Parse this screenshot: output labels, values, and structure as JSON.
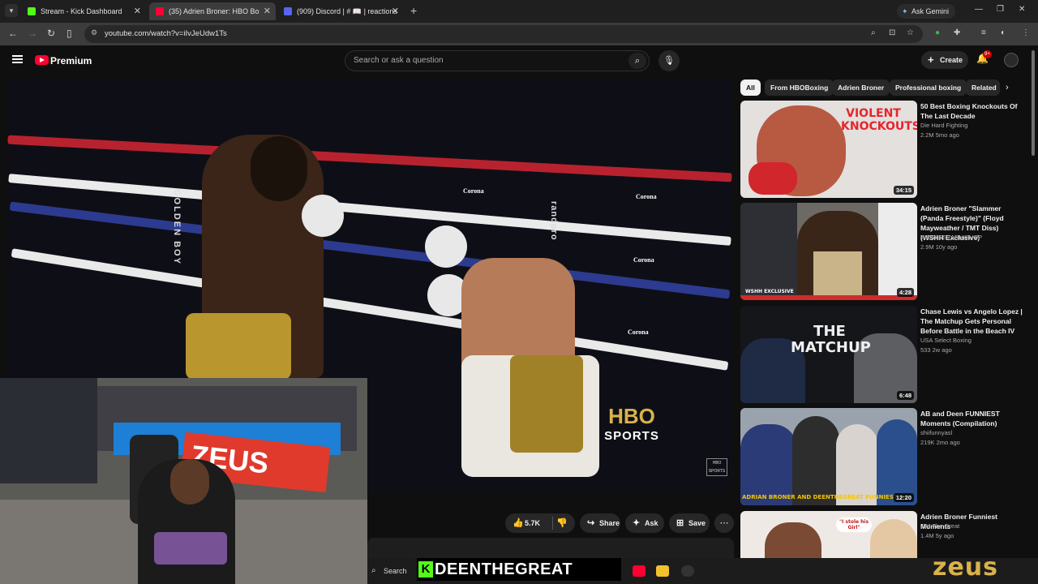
{
  "browser": {
    "tabs": [
      {
        "title": "Stream - Kick Dashboard",
        "active": false,
        "icon_color": "#53fc18"
      },
      {
        "title": "(35) Adrien Broner: HBO Bo",
        "active": true,
        "icon_color": "#ff0033"
      },
      {
        "title": "(909) Discord | # 📖 | reactions",
        "active": false,
        "icon_color": "#5865f2"
      }
    ],
    "new_tab": "+",
    "gemini_label": "Ask Gemini",
    "url": "youtube.com/watch?v=iIvJeUdw1Ts"
  },
  "youtube": {
    "brand": "Premium",
    "search_placeholder": "Search or ask a question",
    "create_label": "Create",
    "notification_count": "9+",
    "chips": [
      "All",
      "From HBOBoxing",
      "Adrien Broner",
      "Professional boxing",
      "Related"
    ],
    "actions": {
      "likes": "5.7K",
      "share": "Share",
      "ask": "Ask",
      "save": "Save"
    },
    "video_overlay": {
      "ring_sponsor": "Corona",
      "canvas_brand": "randpro",
      "corner_text": "GOLDEN BOY",
      "network_top": "HBO",
      "network_bottom": "SPORTS",
      "watermark": "HBO SPORTS"
    },
    "recommendations": [
      {
        "title": "50 Best Boxing Knockouts Of The Last Decade",
        "channel": "Die Hard Fighting",
        "meta": "2.2M  5mo ago",
        "duration": "34:15",
        "thumb_text": "VIOLENT KNOCKOUTS"
      },
      {
        "title": "Adrien Broner \"Slammer (Panda Freestyle)\" (Floyd Mayweather / TMT Diss) (WSHH Exclusive)",
        "channel": "WORLDSTARHIPHOP",
        "meta": "2.9M  10y ago",
        "duration": "4:28",
        "thumb_text": "WSHH EXCLUSIVE"
      },
      {
        "title": "Chase Lewis vs Angelo Lopez | The Matchup Gets Personal Before Battle in the Beach IV",
        "channel": "USA Select Boxing",
        "meta": "533  2w ago",
        "duration": "6:48",
        "thumb_text": "THE MATCHUP"
      },
      {
        "title": "AB and Deen FUNNIEST Moments (Compilation)",
        "channel": "shiifunnyasl",
        "meta": "219K  2mo ago",
        "duration": "12:20",
        "thumb_text": "ADRIAN BRONER AND DEENTHEGREAT FUNNIEST MO"
      },
      {
        "title": "Adrien Broner Funniest Moments",
        "channel": "JPJ The Great",
        "meta": "1.4M  5y ago",
        "duration": "",
        "thumb_text": "\"I stole his Girl\""
      }
    ]
  },
  "stream_overlay": {
    "kick_banner": "DEENTHEGREAT",
    "kick_letter": "K",
    "sponsor": "zeus",
    "cam_banner": "ZEUS"
  },
  "taskbar": {
    "search_label": "Search"
  }
}
